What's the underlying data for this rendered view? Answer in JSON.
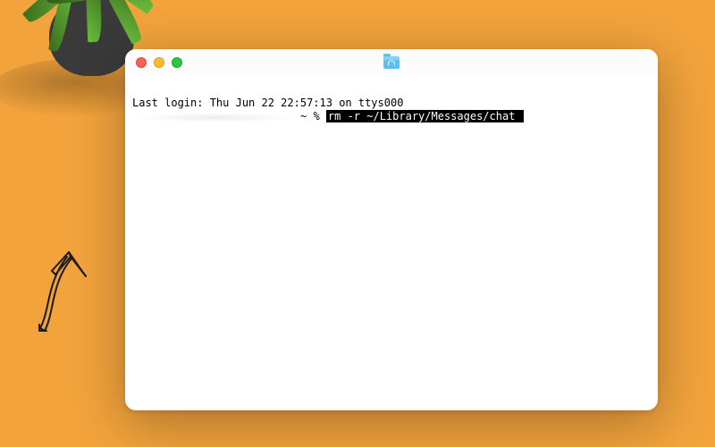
{
  "window": {
    "traffic_lights": {
      "close": "close",
      "minimize": "minimize",
      "zoom": "zoom"
    },
    "title_icon": "home-folder-icon"
  },
  "terminal": {
    "last_login_line": "Last login: Thu Jun 22 22:57:13 on ttys000",
    "prompt_fragment": "~ % ",
    "highlighted_command": "rm -r ~/Library/Messages/chat ",
    "cursor_bg": "#000000"
  },
  "decor": {
    "arrow_name": "sketched-arrow",
    "plant_name": "potted-plant"
  },
  "colors": {
    "page_bg": "#f2a33c",
    "window_bg": "#ffffff",
    "traffic_red": "#ff5f57",
    "traffic_yellow": "#febc2e",
    "traffic_green": "#28c840",
    "highlight": "#000000"
  }
}
